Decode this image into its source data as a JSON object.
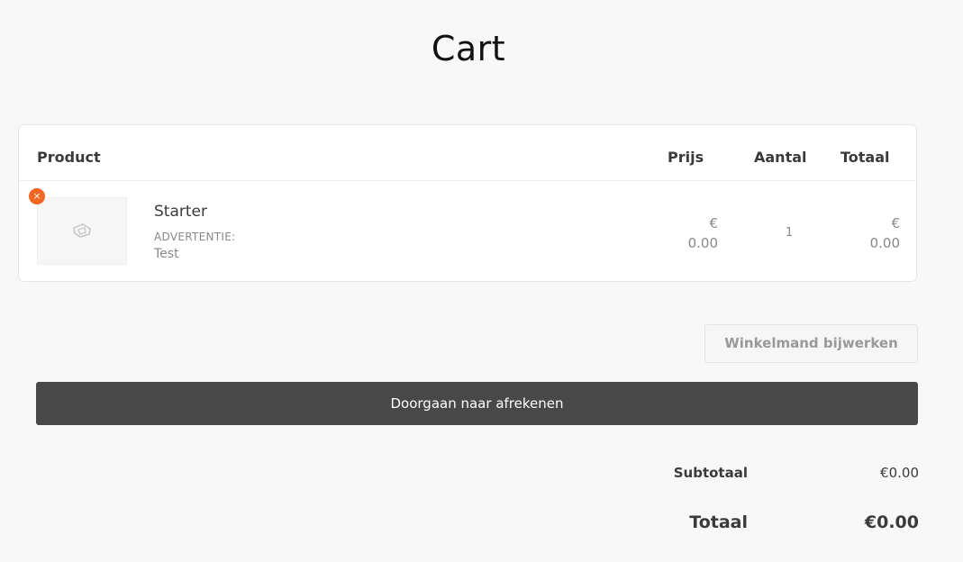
{
  "page": {
    "title": "Cart"
  },
  "table": {
    "headers": {
      "product": "Product",
      "price": "Prijs",
      "quantity": "Aantal",
      "total": "Totaal"
    },
    "items": [
      {
        "name": "Starter",
        "meta_key": "ADVERTENTIE:",
        "meta_value": "Test",
        "price_currency": "€",
        "price_amount": "0.00",
        "quantity": "1",
        "total_currency": "€",
        "total_amount": "0.00",
        "remove_icon": "×"
      }
    ]
  },
  "buttons": {
    "update_cart": "Winkelmand bijwerken",
    "checkout": "Doorgaan naar afrekenen"
  },
  "totals": {
    "subtotal_label": "Subtotaal",
    "subtotal_value": "€0.00",
    "total_label": "Totaal",
    "total_value": "€0.00"
  },
  "colors": {
    "remove_accent": "#f26522",
    "checkout_bg": "#484848"
  },
  "icons": {
    "remove": "close-icon",
    "placeholder": "image-placeholder-icon"
  }
}
